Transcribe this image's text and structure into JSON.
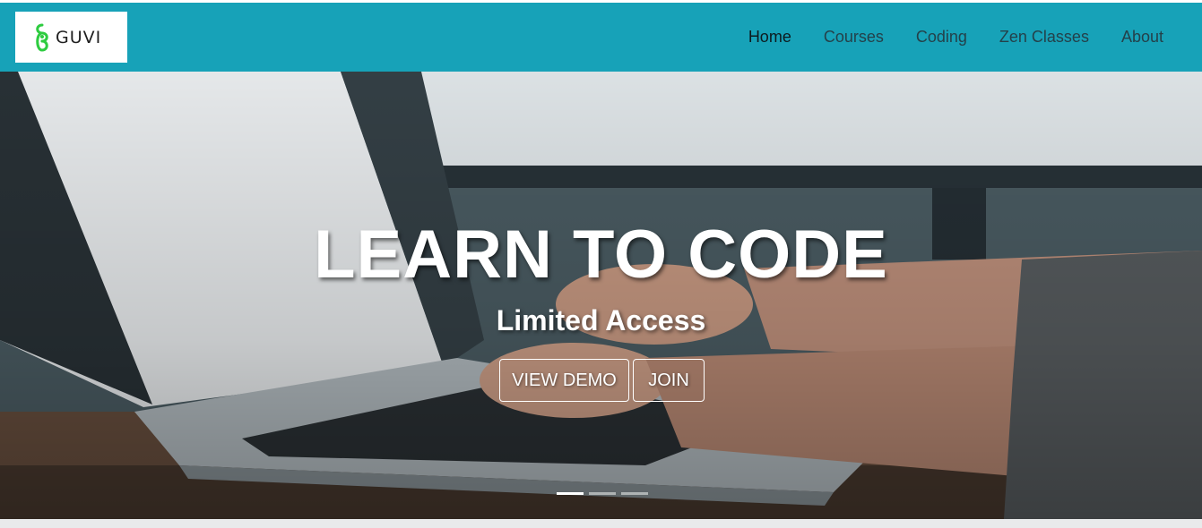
{
  "brand": {
    "name": "GUVI",
    "accent": "#2ecc40"
  },
  "colors": {
    "navbar": "#17a2b8",
    "nav_text": "#24414a",
    "hero_text": "#ffffff"
  },
  "nav": {
    "items": [
      {
        "label": "Home",
        "active": true
      },
      {
        "label": "Courses",
        "active": false
      },
      {
        "label": "Coding",
        "active": false
      },
      {
        "label": "Zen Classes",
        "active": false
      },
      {
        "label": "About",
        "active": false
      }
    ]
  },
  "hero": {
    "title": "LEARN TO CODE",
    "subtitle": "Limited Access",
    "buttons": {
      "demo": "VIEW DEMO",
      "join": "JOIN"
    },
    "slides": {
      "count": 3,
      "active_index": 0
    }
  }
}
